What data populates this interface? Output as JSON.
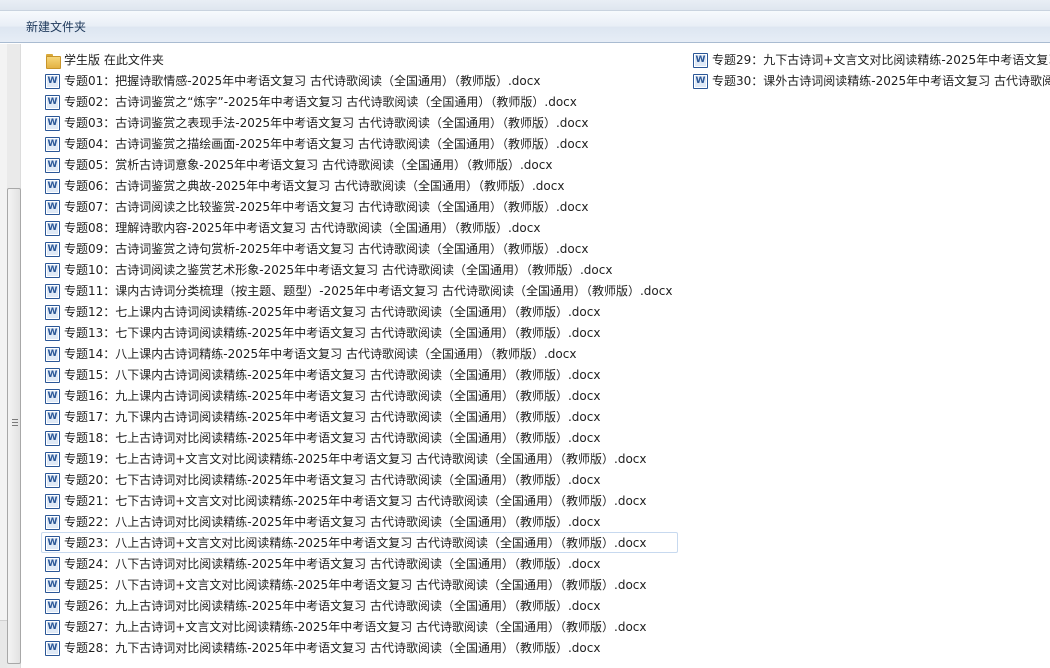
{
  "toolbar": {
    "new_folder_label": "新建文件夹"
  },
  "folder": {
    "name": "学生版 在此文件夹",
    "icon": "folder-icon"
  },
  "files": [
    "专题01：把握诗歌情感-2025年中考语文复习 古代诗歌阅读（全国通用）（教师版）.docx",
    "专题02：古诗词鉴赏之“炼字”-2025年中考语文复习 古代诗歌阅读（全国通用）（教师版）.docx",
    "专题03：古诗词鉴赏之表现手法-2025年中考语文复习 古代诗歌阅读（全国通用）（教师版）.docx",
    "专题04：古诗词鉴赏之描绘画面-2025年中考语文复习 古代诗歌阅读（全国通用）（教师版）.docx",
    "专题05：赏析古诗词意象-2025年中考语文复习 古代诗歌阅读（全国通用）（教师版）.docx",
    "专题06：古诗词鉴赏之典故-2025年中考语文复习 古代诗歌阅读（全国通用）（教师版）.docx",
    "专题07：古诗词阅读之比较鉴赏-2025年中考语文复习 古代诗歌阅读（全国通用）（教师版）.docx",
    "专题08：理解诗歌内容-2025年中考语文复习 古代诗歌阅读（全国通用）（教师版）.docx",
    "专题09：古诗词鉴赏之诗句赏析-2025年中考语文复习 古代诗歌阅读（全国通用）（教师版）.docx",
    "专题10：古诗词阅读之鉴赏艺术形象-2025年中考语文复习 古代诗歌阅读（全国通用）（教师版）.docx",
    "专题11：课内古诗词分类梳理（按主题、题型）-2025年中考语文复习 古代诗歌阅读（全国通用）（教师版）.docx",
    "专题12：七上课内古诗词阅读精练-2025年中考语文复习 古代诗歌阅读（全国通用）（教师版）.docx",
    "专题13：七下课内古诗词阅读精练-2025年中考语文复习 古代诗歌阅读（全国通用）（教师版）.docx",
    "专题14：八上课内古诗词精练-2025年中考语文复习 古代诗歌阅读（全国通用）（教师版）.docx",
    "专题15：八下课内古诗词阅读精练-2025年中考语文复习 古代诗歌阅读（全国通用）（教师版）.docx",
    "专题16：九上课内古诗词阅读精练-2025年中考语文复习 古代诗歌阅读（全国通用）（教师版）.docx",
    "专题17：九下课内古诗词阅读精练-2025年中考语文复习 古代诗歌阅读（全国通用）（教师版）.docx",
    "专题18：七上古诗词对比阅读精练-2025年中考语文复习 古代诗歌阅读（全国通用）（教师版）.docx",
    "专题19：七上古诗词+文言文对比阅读精练-2025年中考语文复习 古代诗歌阅读（全国通用）（教师版）.docx",
    "专题20：七下古诗词对比阅读精练-2025年中考语文复习 古代诗歌阅读（全国通用）（教师版）.docx",
    "专题21：七下古诗词+文言文对比阅读精练-2025年中考语文复习 古代诗歌阅读（全国通用）（教师版）.docx",
    "专题22：八上古诗词对比阅读精练-2025年中考语文复习 古代诗歌阅读（全国通用）（教师版）.docx",
    "专题23：八上古诗词+文言文对比阅读精练-2025年中考语文复习 古代诗歌阅读（全国通用）（教师版）.docx",
    "专题24：八下古诗词对比阅读精练-2025年中考语文复习 古代诗歌阅读（全国通用）（教师版）.docx",
    "专题25：八下古诗词+文言文对比阅读精练-2025年中考语文复习 古代诗歌阅读（全国通用）（教师版）.docx",
    "专题26：九上古诗词对比阅读精练-2025年中考语文复习 古代诗歌阅读（全国通用）（教师版）.docx",
    "专题27：九上古诗词+文言文对比阅读精练-2025年中考语文复习 古代诗歌阅读（全国通用）（教师版）.docx",
    "专题28：九下古诗词对比阅读精练-2025年中考语文复习 古代诗歌阅读（全国通用）（教师版）.docx"
  ],
  "files_col2": [
    "专题29：九下古诗词+文言文对比阅读精练-2025年中考语文复习",
    "专题30：课外古诗词阅读精练-2025年中考语文复习 古代诗歌阅"
  ],
  "selected_file": "专题23：八上古诗词+文言文对比阅读精练-2025年中考语文复习 古代诗歌阅读（全国通用）（教师版）.docx",
  "file_icon": "word-document-icon"
}
